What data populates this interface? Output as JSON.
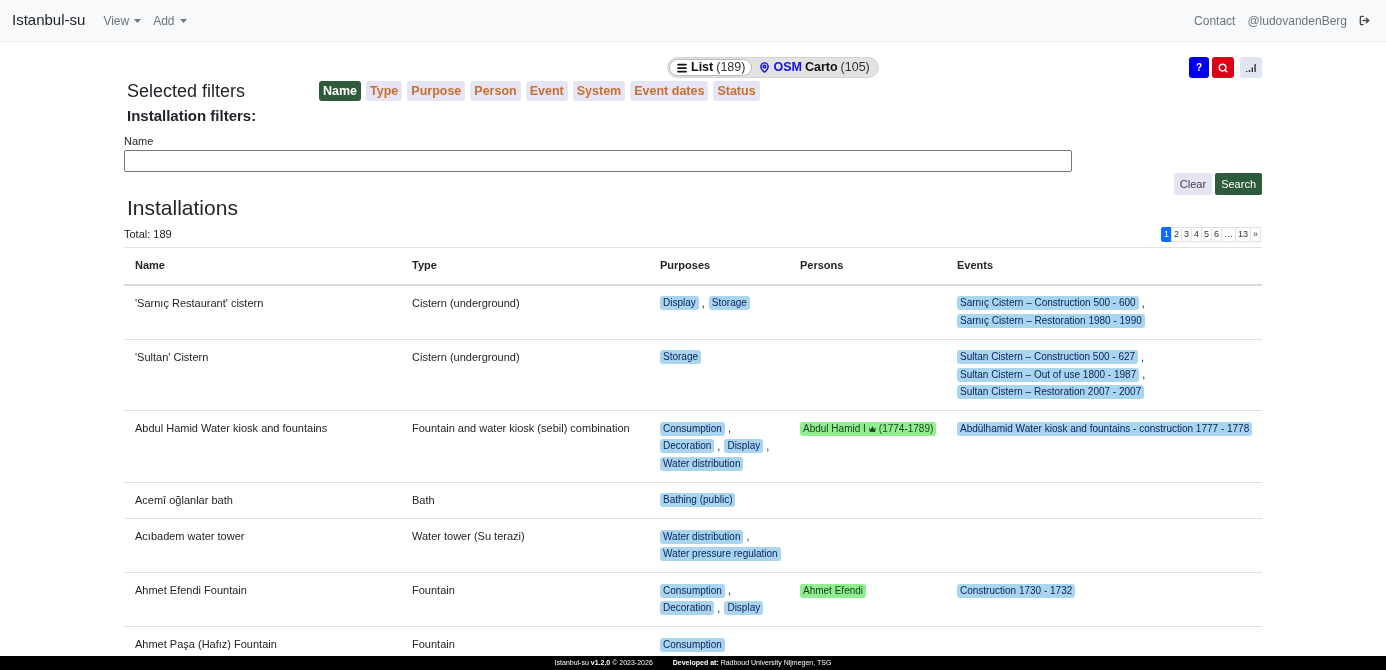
{
  "navbar": {
    "brand": "Istanbul-su",
    "menus": [
      {
        "label": "View"
      },
      {
        "label": "Add"
      }
    ],
    "links": [
      {
        "label": "Contact"
      },
      {
        "label": "@ludovandenBerg"
      }
    ]
  },
  "view_toggle": [
    {
      "kind": "list",
      "label": "List",
      "count": "(189)",
      "selected": true
    },
    {
      "kind": "map",
      "label": "OSM",
      "suffix": "Carto",
      "count": "(105)",
      "selected": false
    }
  ],
  "tools": [
    {
      "kind": "help",
      "label": "?"
    },
    {
      "kind": "search"
    },
    {
      "kind": "chart"
    }
  ],
  "filters": {
    "title": "Selected filters",
    "tabs": [
      {
        "label": "Name",
        "selected": true
      },
      {
        "label": "Type",
        "selected": false
      },
      {
        "label": "Purpose",
        "selected": false
      },
      {
        "label": "Person",
        "selected": false
      },
      {
        "label": "Event",
        "selected": false
      },
      {
        "label": "System",
        "selected": false
      },
      {
        "label": "Event dates",
        "selected": false
      },
      {
        "label": "Status",
        "selected": false
      }
    ],
    "subtitle": "Installation filters:",
    "field": {
      "label": "Name"
    },
    "buttons": [
      {
        "kind": "clear",
        "label": "Clear"
      },
      {
        "kind": "search",
        "label": "Search"
      }
    ]
  },
  "installations": {
    "title": "Installations",
    "total": "Total: 189",
    "pages": [
      {
        "label": "1",
        "selected": true
      },
      {
        "label": "2",
        "selected": false
      },
      {
        "label": "3",
        "selected": false
      },
      {
        "label": "4",
        "selected": false
      },
      {
        "label": "5",
        "selected": false
      },
      {
        "label": "6",
        "selected": false
      },
      {
        "label": "…",
        "selected": false
      },
      {
        "label": "13",
        "selected": false
      },
      {
        "label": "»",
        "selected": false
      }
    ]
  },
  "table": {
    "columns": [
      "Name",
      "Type",
      "Purposes",
      "Persons",
      "Events"
    ],
    "separator": ",",
    "rows": [
      {
        "name": "'Sarnıç Restaurant' cistern",
        "type": "Cistern (underground)",
        "purposes": [
          "Display",
          "Storage"
        ],
        "persons": [],
        "events": [
          "Sarnıç Cistern – Construction 500 - 600",
          "Sarnıç Cistern – Restoration 1980 - 1990"
        ]
      },
      {
        "name": "'Sultan' Cistern",
        "type": "Cistern (underground)",
        "purposes": [
          "Storage"
        ],
        "persons": [],
        "events": [
          "Sultan Cistern – Construction 500 - 627",
          "Sultan Cistern – Out of use 1800 - 1987",
          "Sultan Cistern – Restoration 2007 - 2007"
        ]
      },
      {
        "name": "Abdul Hamid Water kiosk and fountains",
        "type": "Fountain and water kiosk (sebil) combination",
        "purposes": [
          "Consumption",
          "Decoration",
          "Display",
          "Water distribution"
        ],
        "persons": [
          {
            "kind": "ruler",
            "label": "Abdul Hamid I",
            "dates": "(1774-1789)"
          }
        ],
        "events": [
          "Abdülhamid Water kiosk and fountains - construction 1777 - 1778"
        ]
      },
      {
        "name": "Acemî oğlanlar bath",
        "type": "Bath",
        "purposes": [
          "Bathing (public)"
        ],
        "persons": [],
        "events": []
      },
      {
        "name": "Acıbadem water tower",
        "type": "Water tower (Su terazi)",
        "purposes": [
          "Water distribution",
          "Water pressure regulation"
        ],
        "persons": [],
        "events": []
      },
      {
        "name": "Ahmet Efendi Fountain",
        "type": "Fountain",
        "purposes": [
          "Consumption",
          "Decoration",
          "Display"
        ],
        "persons": [
          {
            "kind": "person",
            "label": "Ahmet Efendi"
          }
        ],
        "events": [
          "Construction 1730 - 1732"
        ]
      },
      {
        "name": "Ahmet Paşa (Hafız) Fountain",
        "type": "Fountain",
        "purposes": [
          "Consumption"
        ],
        "persons": [],
        "events": []
      }
    ]
  },
  "footer": {
    "version": "Istanbul-su **v1.2.0** © 2023-2026",
    "credit": "**Developed at:** Radboud University Nijmegen, TSG"
  }
}
